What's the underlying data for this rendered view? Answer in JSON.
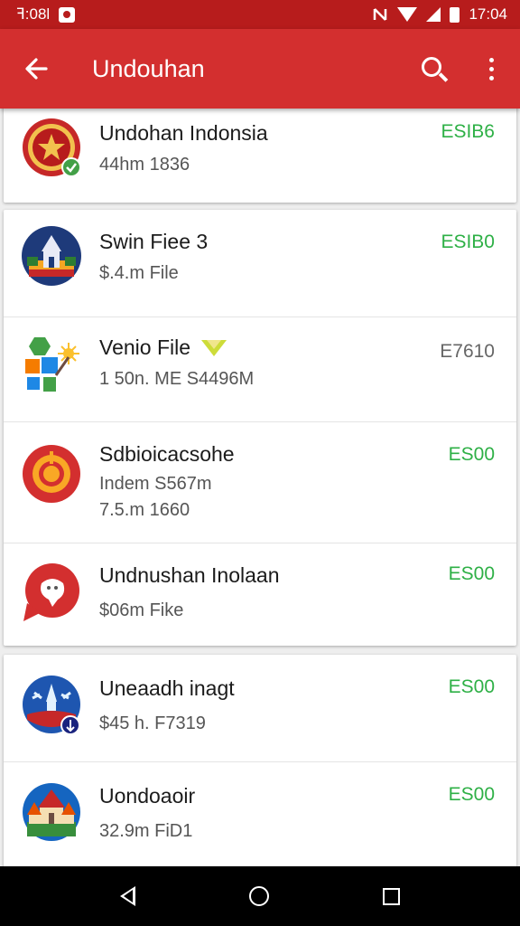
{
  "status_bar": {
    "left_text": "ꟻ:08l",
    "time": "17:04",
    "icons": [
      "photo-icon",
      "nfc-icon",
      "wifi-icon",
      "signal-icon",
      "battery-icon"
    ]
  },
  "app_bar": {
    "title": "Undouhan",
    "back_icon": "arrow-left-icon",
    "search_icon": "search-icon",
    "more_icon": "more-vertical-icon"
  },
  "colors": {
    "status_bar": "#b71c1c",
    "app_bar": "#d32f2f",
    "price_green": "#2eb046",
    "nav_bar": "#000000"
  },
  "cards": [
    {
      "items": [
        {
          "name": "Undohan Indonsia",
          "sub": "44hm 1836",
          "price": "ESIB6",
          "price_color": "green",
          "icon": "emblem-icon"
        }
      ]
    },
    {
      "items": [
        {
          "name": "Swin Fiee 3",
          "sub": "$.4.m File",
          "price": "ESIB0",
          "price_color": "green",
          "icon": "temple-icon"
        },
        {
          "name": "Venio File",
          "sub": "1 50n. ME S4496M",
          "price": "E7610",
          "price_color": "grey",
          "icon": "puzzle-icon",
          "badge_icon": "diamond-icon"
        },
        {
          "name": "Sdbioicacsohe",
          "sub": "Indem S567m",
          "sub2": "7.5.m 1660",
          "price": "ES00",
          "price_color": "green",
          "icon": "target-icon"
        },
        {
          "name": "Undnushan Inolaan",
          "sub": "$06m Fike",
          "price": "ES00",
          "price_color": "green",
          "icon": "chat-bubble-icon"
        }
      ]
    },
    {
      "items": [
        {
          "name": "Uneaadh inagt",
          "sub": "$45 h. F7319",
          "price": "ES00",
          "price_color": "green",
          "icon": "stupa-icon"
        },
        {
          "name": "Uondoaoir",
          "sub": "32.9m FiD1",
          "price": "ES00",
          "price_color": "green",
          "icon": "palace-icon"
        }
      ]
    }
  ],
  "nav_bar": {
    "buttons": [
      "back-triangle-icon",
      "home-circle-icon",
      "recents-square-icon"
    ]
  }
}
